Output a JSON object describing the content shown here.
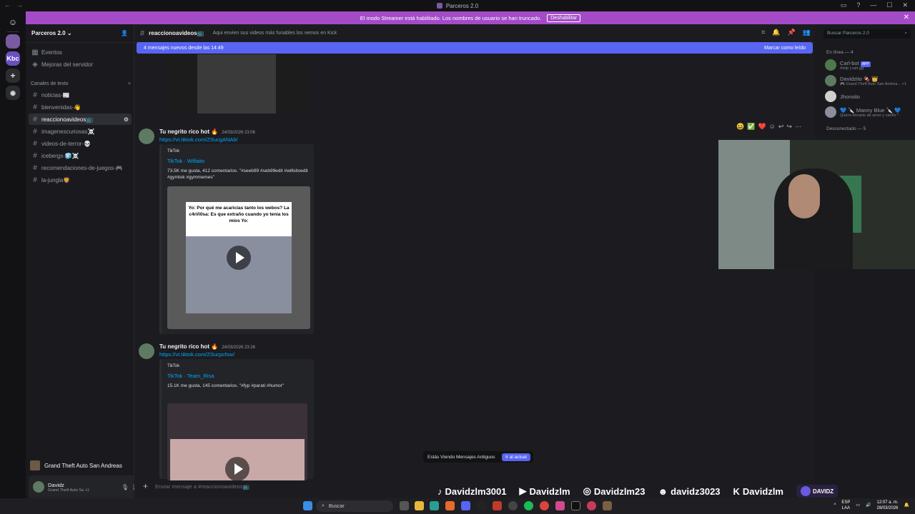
{
  "window": {
    "title": "Parceros 2.0"
  },
  "banner": {
    "text": "El modo Streamer está habilitado. Los nombres de usuario se han truncado.",
    "button": "Deshabilitar"
  },
  "server": {
    "name": "Parceros 2.0"
  },
  "sidebar": {
    "top_items": [
      {
        "label": "Eventos"
      },
      {
        "label": "Mejoras del servidor"
      }
    ],
    "category": "Canales de texto",
    "channels": [
      {
        "label": "noticias-📰"
      },
      {
        "label": "bienvenidas-👋"
      },
      {
        "label": "reaccionoavideos📺"
      },
      {
        "label": "imagenescuriosas☠️"
      },
      {
        "label": "videos-de-terror-💀"
      },
      {
        "label": "icebergs-🧊☠️"
      },
      {
        "label": "recomendaciones-de-juegos-🎮"
      },
      {
        "label": "la-jungla🦁"
      }
    ]
  },
  "activity": {
    "game": "Grand Theft Auto San Andreas"
  },
  "user": {
    "name": "Davidz",
    "status": "Grand Theft Auto Sa +1"
  },
  "channel_header": {
    "name": "reaccionoavideos📺",
    "topic": "Aqui envien sus videos más funables los vemos en Kick"
  },
  "new_messages": {
    "text": "4 mensajes nuevos desde las 14:49",
    "action": "Marcar como leído"
  },
  "messages": [
    {
      "author": "Tu negrito rico hot 🔥",
      "timestamp": "24/03/2026 23:06",
      "link": "https://vt.tiktok.com/ZSucgANAb/",
      "embed": {
        "provider": "TikTok",
        "title": "TikTok · Willaito",
        "description": "73.5K me gusta, 412 comentarios. \"#seeb99 #seb99edit #willsitoedit #gymtok #gymmemes\"",
        "video_text": "Yo: Por qué me acaricias tanto los webos? La c4riñ0sa: Es que extraño cuando yo tenia los mios Yo:"
      }
    },
    {
      "author": "Tu negrito rico hot 🔥",
      "timestamp": "24/03/2026 23:26",
      "link": "https://vt.tiktok.com/ZSucpcfsw/",
      "embed": {
        "provider": "TikTok",
        "title": "TikTok · Team_Risa",
        "description": "15.1K me gusta, 145 comentarios. \"#fyp #parati #humor\""
      }
    }
  ],
  "old_messages_bar": {
    "text": "Estás Viendo Mensajes Antiguos",
    "button": "Ir al actual"
  },
  "composer": {
    "placeholder": "Enviar mensaje a #reaccionoavideos📺"
  },
  "members": {
    "search_placeholder": "Buscar Parceros 2.0",
    "online_header": "En línea — 4",
    "online": [
      {
        "name": "Carl-bot",
        "badge": "APP",
        "status": "/help | carl.gg"
      },
      {
        "name": "Davidzito 🍫 👑",
        "status": "🎮 Grand Theft Auto San Andrea... +1"
      },
      {
        "name": "Jhonsito",
        "status": ""
      },
      {
        "name": "💙 🔪 Manny Blue 🔪 💙",
        "status": "Quiero llenarte de amor y cariño ^"
      }
    ],
    "offline_header": "Desconectado — 5"
  },
  "overlay": {
    "tiktok": "Davidzlm3001",
    "youtube": "Davidzlm",
    "instagram": "Davidzlm23",
    "discord": "davidz3023",
    "kick": "Davidzlm",
    "logo_text": "DAVIDZ"
  },
  "taskbar": {
    "search": "Buscar",
    "lang": "ESP",
    "region": "LAA",
    "time": "12:07 a. m.",
    "date": "28/03/2026"
  },
  "colors": {
    "accent": "#5865f2",
    "banner": "#a44cc8",
    "link": "#00a8fc",
    "background": "#1c1c20"
  }
}
